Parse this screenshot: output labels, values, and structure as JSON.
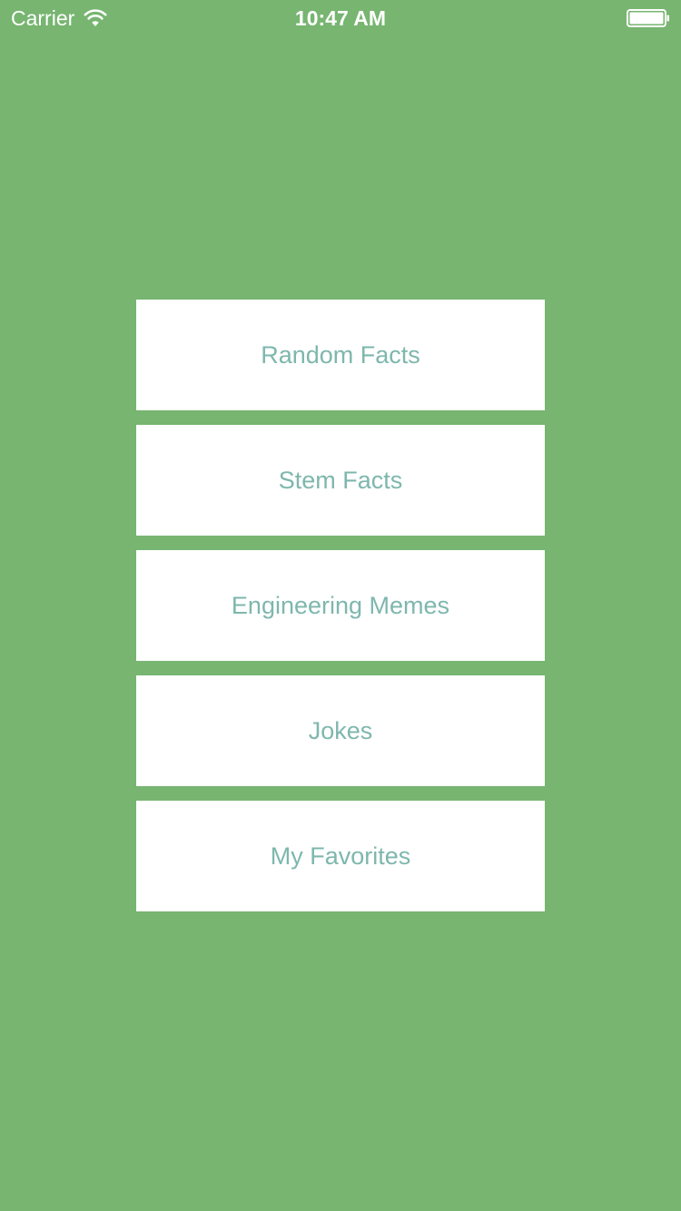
{
  "status_bar": {
    "carrier": "Carrier",
    "time": "10:47 AM",
    "wifi_icon": "wifi-icon",
    "battery_icon": "battery-icon",
    "battery_level": 1.0
  },
  "menu": {
    "buttons": [
      {
        "label": "Random Facts"
      },
      {
        "label": "Stem Facts"
      },
      {
        "label": "Engineering Memes"
      },
      {
        "label": "Jokes"
      },
      {
        "label": "My Favorites"
      }
    ]
  },
  "colors": {
    "background": "#77b571",
    "button_background": "#ffffff",
    "button_text": "#7eb7ad",
    "status_text": "#ffffff"
  }
}
